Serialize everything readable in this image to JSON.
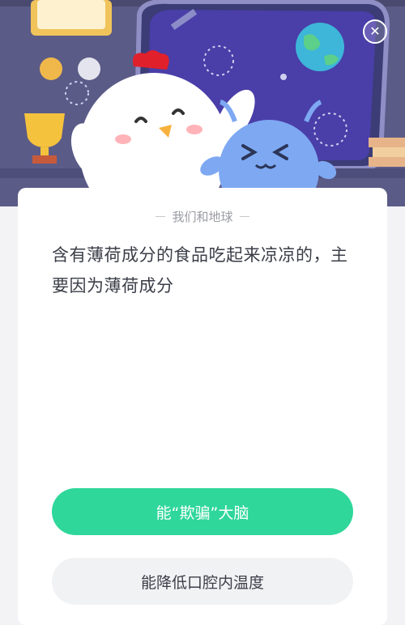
{
  "header": {
    "close_icon": "close-icon"
  },
  "quiz": {
    "category": "我们和地球",
    "question": "含有薄荷成分的食品吃起来凉凉的，主要因为薄荷成分",
    "answers": [
      {
        "label": "能“欺骗”大脑"
      },
      {
        "label": "能降低口腔内温度"
      }
    ]
  },
  "colors": {
    "banner_bg": "#5a5a86",
    "primary_answer": "#2fd79a",
    "secondary_answer": "#f1f2f4"
  }
}
